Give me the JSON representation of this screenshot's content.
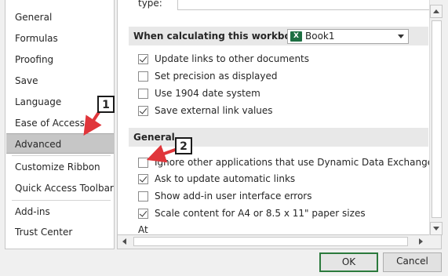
{
  "nav": {
    "items": [
      {
        "label": "General"
      },
      {
        "label": "Formulas"
      },
      {
        "label": "Proofing"
      },
      {
        "label": "Save"
      },
      {
        "label": "Language"
      },
      {
        "label": "Ease of Access"
      },
      {
        "label": "Advanced",
        "selected": true
      },
      {
        "label": "Customize Ribbon"
      },
      {
        "label": "Quick Access Toolbar"
      },
      {
        "label": "Add-ins"
      },
      {
        "label": "Trust Center"
      }
    ]
  },
  "content": {
    "type_label": "type:",
    "calc_section": {
      "title": "When calculating this workbook:",
      "workbook_value": "Book1",
      "options": [
        {
          "label": "Update links to other documents",
          "checked": true
        },
        {
          "label": "Set precision as displayed",
          "checked": false
        },
        {
          "label": "Use 1904 date system",
          "checked": false
        },
        {
          "label": "Save external link values",
          "checked": true
        }
      ]
    },
    "general_section": {
      "title": "General",
      "options": [
        {
          "label": "Ignore other applications that use Dynamic Data Exchange (DDE)",
          "checked": false
        },
        {
          "label": "Ask to update automatic links",
          "checked": true
        },
        {
          "label": "Show add-in user interface errors",
          "checked": false
        },
        {
          "label": "Scale content for A4 or 8.5 x 11\" paper sizes",
          "checked": true
        }
      ],
      "next_label": "At"
    }
  },
  "buttons": {
    "ok": "OK",
    "cancel": "Cancel"
  },
  "annotations": {
    "step1": "1",
    "step2": "2"
  },
  "colors": {
    "selected_nav": "#c6c6c6",
    "ok_border": "#2b7a3d",
    "annotation_arrow": "#e0363b",
    "excel_green": "#1d6f42"
  },
  "icons": {
    "workbook": "excel-icon",
    "checkbox": "checkbox"
  }
}
